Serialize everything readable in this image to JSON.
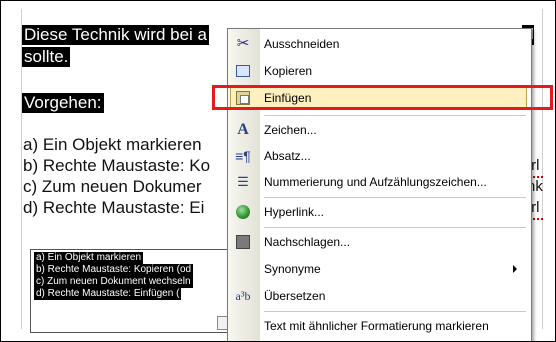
{
  "document": {
    "lines": [
      "Diese Technik wird bei a",
      "sollte.",
      "Vorgehen:",
      "a) Ein Objekt markieren",
      "b) Rechte Maustaste: Ko",
      "c) Zum neuen Dokumer",
      "d) Rechte Maustaste: Ei"
    ],
    "right_fragments": [
      "el",
      "trl",
      "nk",
      "trl"
    ]
  },
  "mini_doc": {
    "lines": [
      "a) Ein Objekt markieren",
      "b) Rechte Maustaste: Kopieren (od",
      "c) Zum neuen Dokument wechseln",
      "d) Rechte Maustaste: Einfügen ("
    ]
  },
  "context_menu": {
    "items": [
      {
        "label": "Ausschneiden",
        "icon": "scissors-icon"
      },
      {
        "label": "Kopieren",
        "icon": "copy-icon"
      },
      {
        "label": "Einfügen",
        "icon": "paste-icon",
        "highlighted": true
      },
      {
        "label": "Zeichen...",
        "icon": "font-icon"
      },
      {
        "label": "Absatz...",
        "icon": "paragraph-icon"
      },
      {
        "label": "Nummerierung und Aufzählungszeichen...",
        "icon": "list-icon"
      },
      {
        "label": "Hyperlink...",
        "icon": "hyperlink-icon"
      },
      {
        "label": "Nachschlagen...",
        "icon": "research-icon"
      },
      {
        "label": "Synonyme",
        "icon": "",
        "submenu": true
      },
      {
        "label": "Übersetzen",
        "icon": "translate-icon"
      },
      {
        "label": "Text mit ähnlicher Formatierung markieren",
        "icon": ""
      }
    ]
  },
  "colors": {
    "highlight_bg": "#fff0bf",
    "highlight_border": "#c9a34a",
    "annotation_red": "#e41b1b"
  }
}
